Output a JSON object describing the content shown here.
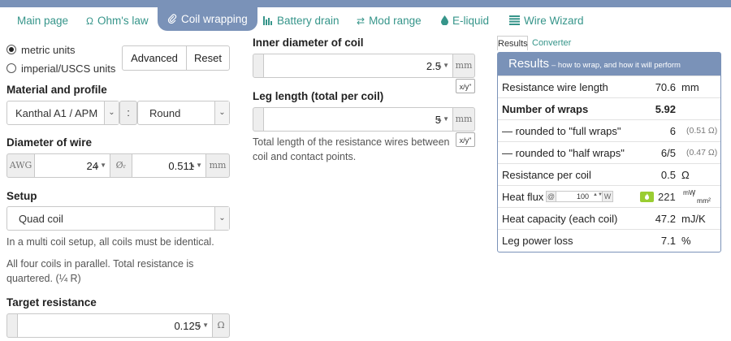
{
  "nav": {
    "tabs": [
      {
        "label": "Main page"
      },
      {
        "label": "Ohm's law",
        "icon": "omega-icon"
      },
      {
        "label": "Coil wrapping",
        "icon": "paperclip-icon",
        "active": true
      },
      {
        "label": "Battery drain",
        "icon": "bar-chart-icon"
      },
      {
        "label": "Mod range",
        "icon": "swap-arrows-icon"
      },
      {
        "label": "E-liquid",
        "icon": "droplet-icon"
      },
      {
        "label": "Wire Wizard",
        "icon": "list-icon"
      }
    ]
  },
  "units": {
    "metric": "metric units",
    "imperial": "imperial/USCS units",
    "selected": "metric",
    "advanced_label": "Advanced",
    "reset_label": "Reset"
  },
  "material": {
    "heading": "Material and profile",
    "material_value": "Kanthal A1 / APM",
    "separator": ":",
    "profile_value": "Round"
  },
  "diameter": {
    "heading": "Diameter of wire",
    "awg_label": "AWG",
    "awg_value": "24",
    "dia_label": "Øᵣ",
    "dia_value": "0.511",
    "dia_unit": "mm"
  },
  "setup": {
    "heading": "Setup",
    "value": "Quad coil",
    "note1": "In a multi coil setup, all coils must be identical.",
    "note2": "All four coils in parallel. Total resistance is quartered. (¼ R)"
  },
  "target": {
    "heading": "Target resistance",
    "value": "0.125",
    "unit": "Ω"
  },
  "inner": {
    "heading": "Inner diameter of coil",
    "value": "2.5",
    "unit": "mm",
    "xy": "x/y\""
  },
  "leg": {
    "heading": "Leg length (total per coil)",
    "value": "5",
    "unit": "mm",
    "xy": "x/y\"",
    "note": "Total length of the resistance wires between coil and contact points."
  },
  "results": {
    "tab_results": "Results",
    "tab_converter": "Converter",
    "title": "Results",
    "subtitle": "– how to wrap, and how it will perform",
    "rows": [
      {
        "label": "Resistance wire length",
        "value": "70.6",
        "unit": "mm"
      },
      {
        "label": "Number of wraps",
        "value": "5.92",
        "unit": "",
        "bold": true
      },
      {
        "label": "— rounded to \"full wraps\"",
        "value": "6",
        "sub": "(0.51 Ω)"
      },
      {
        "label": "— rounded to \"half wraps\"",
        "value": "6/5",
        "sub": "(0.47 Ω)"
      },
      {
        "label": "Resistance per coil",
        "value": "0.5",
        "unit": "Ω"
      },
      {
        "label": "Heat flux",
        "at": "@",
        "watts": "100",
        "w": "W",
        "value": "221",
        "unit_top": "mW",
        "unit_bottom": "mm²"
      },
      {
        "label": "Heat capacity (each coil)",
        "value": "47.2",
        "unit": "mJ/K"
      },
      {
        "label": "Leg power loss",
        "value": "7.1",
        "unit": "%"
      }
    ]
  },
  "colors": {
    "accent": "#7a92b8",
    "link": "#36958a",
    "heat_badge": "#9acd32"
  }
}
